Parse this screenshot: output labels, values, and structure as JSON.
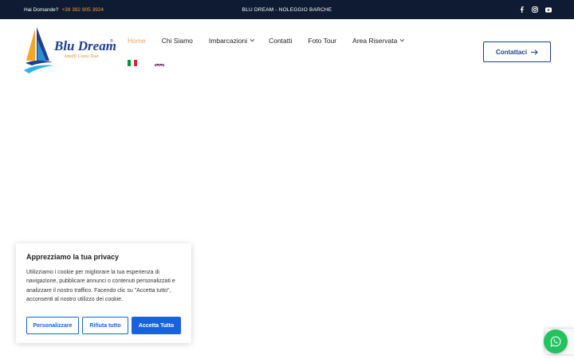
{
  "topbar": {
    "question": "Hai Domande?",
    "phone": "+39 392 905 3924",
    "center_text": "BLU DREAM - NOLEGGIO BARCHE",
    "social": [
      "facebook-icon",
      "instagram-icon",
      "youtube-icon"
    ]
  },
  "logo": {
    "brand": "Blu Dream",
    "registered": "®",
    "tagline": "Amalfi Coast Tour"
  },
  "nav": {
    "items": [
      {
        "label": "Home",
        "active": true
      },
      {
        "label": "Chi Siamo"
      },
      {
        "label": "Imbarcazioni",
        "dropdown": true
      },
      {
        "label": "Contatti"
      },
      {
        "label": "Foto Tour"
      },
      {
        "label": "Area Riservata",
        "dropdown": true
      }
    ],
    "languages": [
      "it",
      "en"
    ]
  },
  "cta": {
    "label": "Contattaci"
  },
  "cookie": {
    "title": "Apprezziamo la tua privacy",
    "text": "Utilizziamo i cookie per migliorare la tua esperienza di navigazione, pubblicare annunci o contenuti personalizzati e analizzare il nostro traffico. Facendo clic su \"Accetta tutto\", acconsenti al nostro utilizzo dei cookie.",
    "buttons": {
      "customize": "Personalizzare",
      "reject": "Rifiuta tutto",
      "accept": "Accetta Tutto"
    }
  },
  "colors": {
    "topbar_bg": "#0f1a33",
    "phone": "#f0a12a",
    "brand_blue": "#1d3f8f",
    "nav_active": "#e9a35a",
    "cookie_blue": "#1863dc",
    "whatsapp": "#22c35e"
  }
}
